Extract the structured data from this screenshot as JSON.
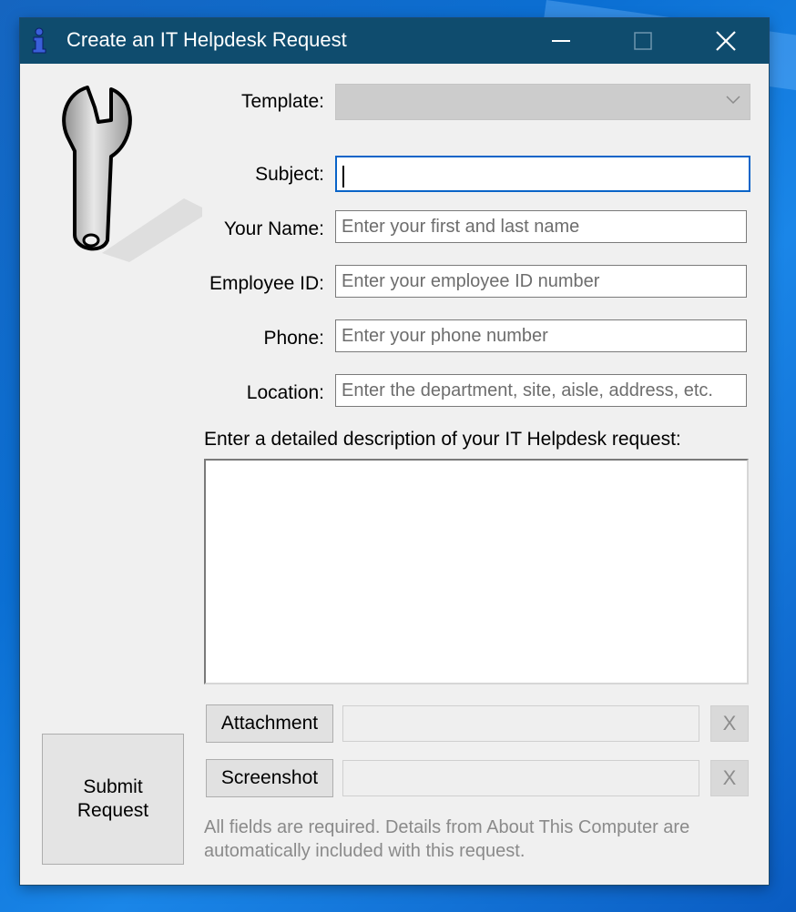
{
  "window": {
    "title": "Create an IT Helpdesk Request",
    "icon": "info-person-icon",
    "controls": [
      "minimize-icon",
      "maximize-icon",
      "close-icon"
    ]
  },
  "form": {
    "template_label": "Template:",
    "template_value": "",
    "subject_label": "Subject:",
    "subject_value": "",
    "name_label": "Your Name:",
    "name_placeholder": "Enter your first and last name",
    "employee_id_label": "Employee ID:",
    "employee_id_placeholder": "Enter your employee ID number",
    "phone_label": "Phone:",
    "phone_placeholder": "Enter your phone number",
    "location_label": "Location:",
    "location_placeholder": "Enter the department, site, aisle, address, etc.",
    "description_label": "Enter a detailed description of your IT Helpdesk request:",
    "description_value": ""
  },
  "attachments": {
    "attachment_button": "Attachment",
    "attachment_path": "",
    "attachment_clear": "X",
    "screenshot_button": "Screenshot",
    "screenshot_path": "",
    "screenshot_clear": "X"
  },
  "submit_label": "Submit\nRequest",
  "footer_note": "All fields are required. Details from About This Computer are automatically included with this request.",
  "colors": {
    "titlebar": "#0f4c6e",
    "window_bg": "#f0f0f0",
    "focus_border": "#0a64c8",
    "desktop": "#0b6fd3"
  }
}
